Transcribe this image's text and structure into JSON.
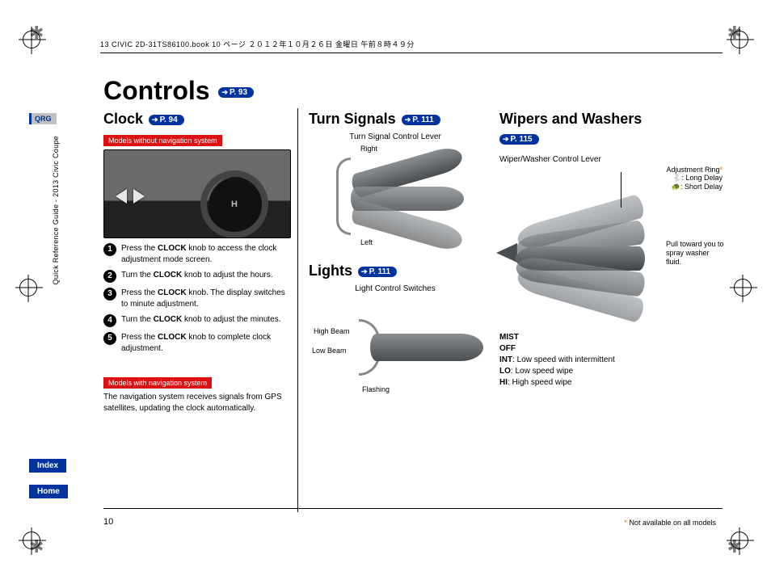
{
  "header": {
    "running": "13 CIVIC 2D-31TS86100.book  10 ページ  ２０１２年１０月２６日  金曜日  午前８時４９分"
  },
  "sidebar": {
    "qrg": "QRG",
    "guide": "Quick Reference Guide - 2013 Civic Coupe",
    "index": "Index",
    "home": "Home"
  },
  "title": "Controls",
  "title_ref": "P. 93",
  "clock": {
    "heading": "Clock",
    "ref": "P. 94",
    "chip_no_nav": "Models without navigation system",
    "chip_nav": "Models with navigation system",
    "nav_text": "The navigation system receives signals from GPS satellites, updating the clock automatically.",
    "steps": [
      {
        "n": "1",
        "pre": "Press the ",
        "bold": "CLOCK",
        "post": " knob to access the clock adjustment mode screen."
      },
      {
        "n": "2",
        "pre": "Turn the ",
        "bold": "CLOCK",
        "post": " knob to adjust the hours."
      },
      {
        "n": "3",
        "pre": "Press the ",
        "bold": "CLOCK",
        "post": " knob. The display switches to minute adjustment."
      },
      {
        "n": "4",
        "pre": "Turn the ",
        "bold": "CLOCK",
        "post": " knob to adjust the minutes."
      },
      {
        "n": "5",
        "pre": "Press the ",
        "bold": "CLOCK",
        "post": " knob to complete clock adjustment."
      }
    ]
  },
  "turn": {
    "heading": "Turn Signals",
    "ref": "P. 111",
    "caption": "Turn Signal Control Lever",
    "right": "Right",
    "left": "Left"
  },
  "lights": {
    "heading": "Lights",
    "ref": "P. 111",
    "caption": "Light Control Switches",
    "high": "High Beam",
    "low": "Low Beam",
    "flash": "Flashing"
  },
  "wipers": {
    "heading": "Wipers and Washers",
    "ref": "P. 115",
    "caption": "Wiper/Washer Control Lever",
    "ring": "Adjustment Ring",
    "long_delay": ": Long Delay",
    "short_delay": ": Short Delay",
    "pull": "Pull toward you to spray washer fluid.",
    "modes": {
      "mist": "MIST",
      "off": "OFF",
      "int_b": "INT",
      "int_t": ": Low speed with intermittent",
      "lo_b": "LO",
      "lo_t": ": Low speed wipe",
      "hi_b": "HI",
      "hi_t": ": High speed wipe"
    }
  },
  "footnote": "Not available on all models",
  "star": "*",
  "page_number": "10"
}
